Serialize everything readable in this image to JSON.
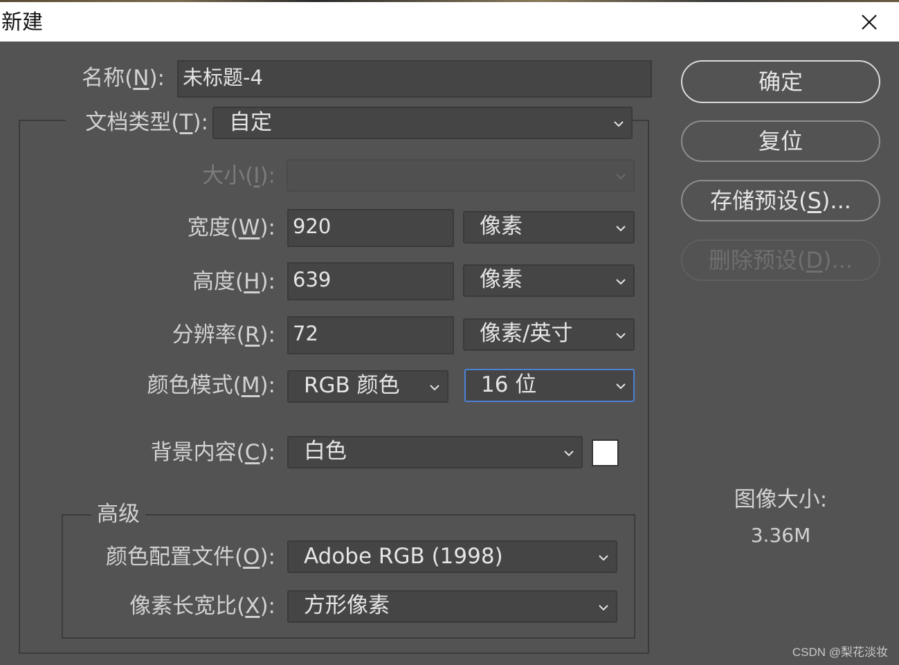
{
  "window": {
    "title": "新建"
  },
  "form": {
    "name": {
      "label_pre": "名称(",
      "hotkey": "N",
      "label_post": "):",
      "value": "未标题-4"
    },
    "doc_type": {
      "label_pre": "文档类型(",
      "hotkey": "T",
      "label_post": "):",
      "value": "自定"
    },
    "size": {
      "label_pre": "大小(",
      "hotkey": "I",
      "label_post": "):",
      "value": ""
    },
    "width": {
      "label_pre": "宽度(",
      "hotkey": "W",
      "label_post": "):",
      "value": "920",
      "unit": "像素"
    },
    "height": {
      "label_pre": "高度(",
      "hotkey": "H",
      "label_post": "):",
      "value": "639",
      "unit": "像素"
    },
    "resolution": {
      "label_pre": "分辨率(",
      "hotkey": "R",
      "label_post": "):",
      "value": "72",
      "unit": "像素/英寸"
    },
    "color_mode": {
      "label_pre": "颜色模式(",
      "hotkey": "M",
      "label_post": "):",
      "mode": "RGB 颜色",
      "depth": "16 位"
    },
    "background": {
      "label_pre": "背景内容(",
      "hotkey": "C",
      "label_post": "):",
      "value": "白色",
      "swatch_color": "#ffffff"
    }
  },
  "advanced": {
    "legend": "高级",
    "color_profile": {
      "label_pre": "颜色配置文件(",
      "hotkey": "O",
      "label_post": "):",
      "value": "Adobe RGB (1998)"
    },
    "pixel_aspect": {
      "label_pre": "像素长宽比(",
      "hotkey": "X",
      "label_post": "):",
      "value": "方形像素"
    }
  },
  "buttons": {
    "ok": "确定",
    "reset": "复位",
    "save_preset": {
      "pre": "存储预设(",
      "hotkey": "S",
      "post": ")..."
    },
    "delete_preset": {
      "pre": "删除预设(",
      "hotkey": "D",
      "post": ")..."
    }
  },
  "image_size": {
    "label": "图像大小:",
    "value": "3.36M"
  },
  "watermark": "CSDN @梨花淡妆",
  "colors": {
    "dialog_bg": "#535353",
    "field_bg": "#454545",
    "focus": "#4b82d6"
  }
}
